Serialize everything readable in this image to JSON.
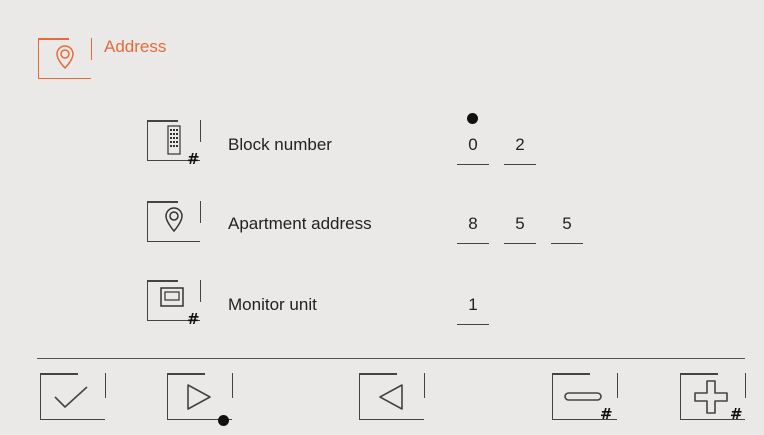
{
  "header": {
    "title": "Address",
    "icon": "location-pin-icon",
    "accent_color": "#e56b3a"
  },
  "rows": [
    {
      "label": "Block number",
      "icon": "building-hash-icon",
      "digits": [
        "0",
        "2"
      ],
      "cursor_index": 0
    },
    {
      "label": "Apartment address",
      "icon": "location-pin-icon",
      "digits": [
        "8",
        "5",
        "5"
      ]
    },
    {
      "label": "Monitor unit",
      "icon": "monitor-hash-icon",
      "digits": [
        "1"
      ]
    }
  ],
  "toolbar": {
    "buttons": [
      {
        "name": "confirm-button",
        "icon": "check-icon"
      },
      {
        "name": "next-button",
        "icon": "play-right-icon",
        "indicator": "dot"
      },
      {
        "name": "previous-button",
        "icon": "play-left-icon"
      },
      {
        "name": "decrement-button",
        "icon": "minus-icon",
        "badge": "#"
      },
      {
        "name": "increment-button",
        "icon": "plus-icon",
        "badge": "#"
      }
    ]
  },
  "badges": {
    "hash": "#"
  }
}
